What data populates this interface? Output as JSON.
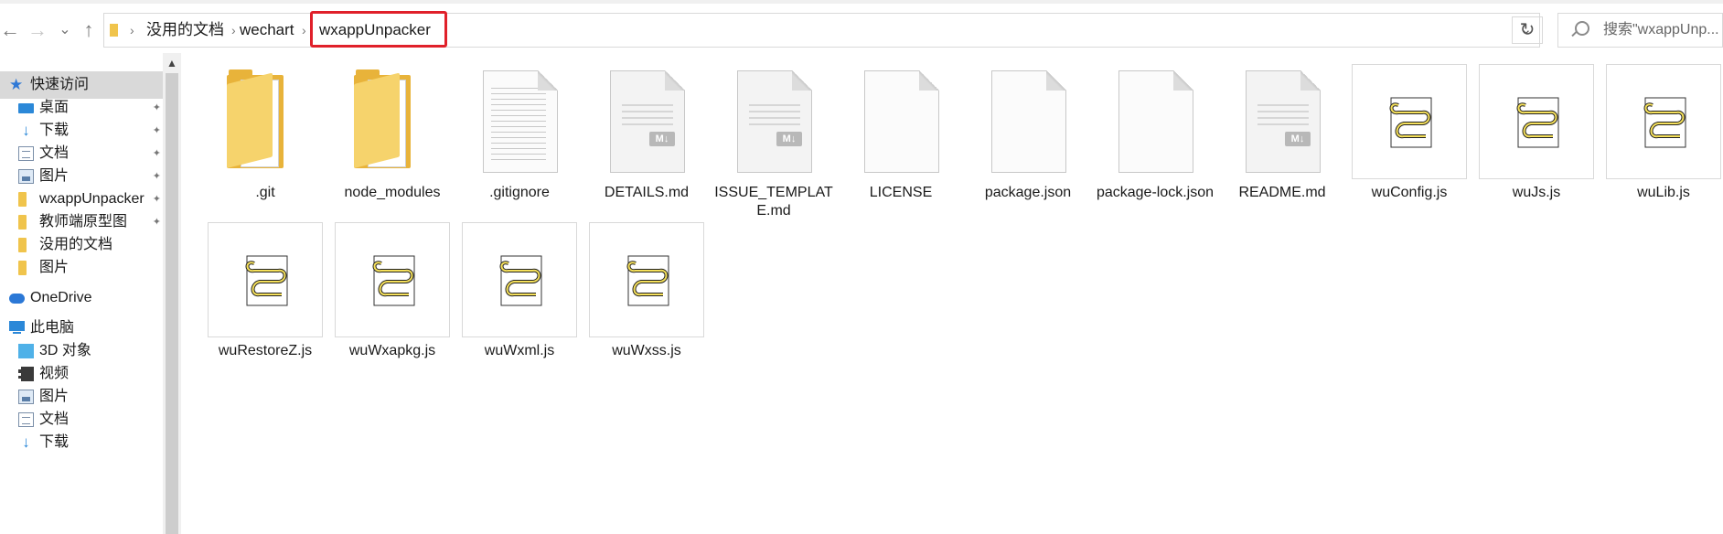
{
  "nav": {
    "back": "←",
    "forward": "→",
    "recent": "⌄",
    "up": "↑"
  },
  "address": {
    "crumbs": [
      "没用的文档",
      "wechart",
      "wxappUnpacker"
    ],
    "separator": "›",
    "dropdown": "⌄"
  },
  "refresh": "↻",
  "search": {
    "placeholder": "搜索\"wxappUnp..."
  },
  "sidebar": {
    "items": [
      {
        "label": "快速访问",
        "icon": "star-icon"
      },
      {
        "label": "桌面",
        "icon": "desktop-icon",
        "pinned": true
      },
      {
        "label": "下载",
        "icon": "download-icon",
        "pinned": true
      },
      {
        "label": "文档",
        "icon": "documents-icon",
        "pinned": true
      },
      {
        "label": "图片",
        "icon": "pictures-icon",
        "pinned": true
      },
      {
        "label": "wxappUnpacker",
        "icon": "folder-icon",
        "pinned": true
      },
      {
        "label": "教师端原型图",
        "icon": "folder-icon",
        "pinned": true
      },
      {
        "label": "没用的文档",
        "icon": "folder-icon"
      },
      {
        "label": "图片",
        "icon": "folder-icon"
      },
      {
        "label": "OneDrive",
        "icon": "onedrive-icon"
      },
      {
        "label": "此电脑",
        "icon": "this-pc-icon"
      },
      {
        "label": "3D 对象",
        "icon": "3d-objects-icon"
      },
      {
        "label": "视频",
        "icon": "videos-icon"
      },
      {
        "label": "图片",
        "icon": "pictures-icon"
      },
      {
        "label": "文档",
        "icon": "documents-icon"
      },
      {
        "label": "下载",
        "icon": "download-icon"
      }
    ],
    "pin_glyph": "📌"
  },
  "files": [
    {
      "name": ".git",
      "type": "folder"
    },
    {
      "name": "node_modules",
      "type": "folder"
    },
    {
      "name": ".gitignore",
      "type": "text"
    },
    {
      "name": "DETAILS.md",
      "type": "markdown"
    },
    {
      "name": "ISSUE_TEMPLATE.md",
      "type": "markdown"
    },
    {
      "name": "LICENSE",
      "type": "blank"
    },
    {
      "name": "package.json",
      "type": "blank"
    },
    {
      "name": "package-lock.json",
      "type": "blank"
    },
    {
      "name": "README.md",
      "type": "markdown"
    },
    {
      "name": "wuConfig.js",
      "type": "js"
    },
    {
      "name": "wuJs.js",
      "type": "js"
    },
    {
      "name": "wuLib.js",
      "type": "js"
    },
    {
      "name": "wuRestoreZ.js",
      "type": "js"
    },
    {
      "name": "wuWxapkg.js",
      "type": "js"
    },
    {
      "name": "wuWxml.js",
      "type": "js"
    },
    {
      "name": "wuWxss.js",
      "type": "js"
    }
  ],
  "md_badge": "M↓"
}
